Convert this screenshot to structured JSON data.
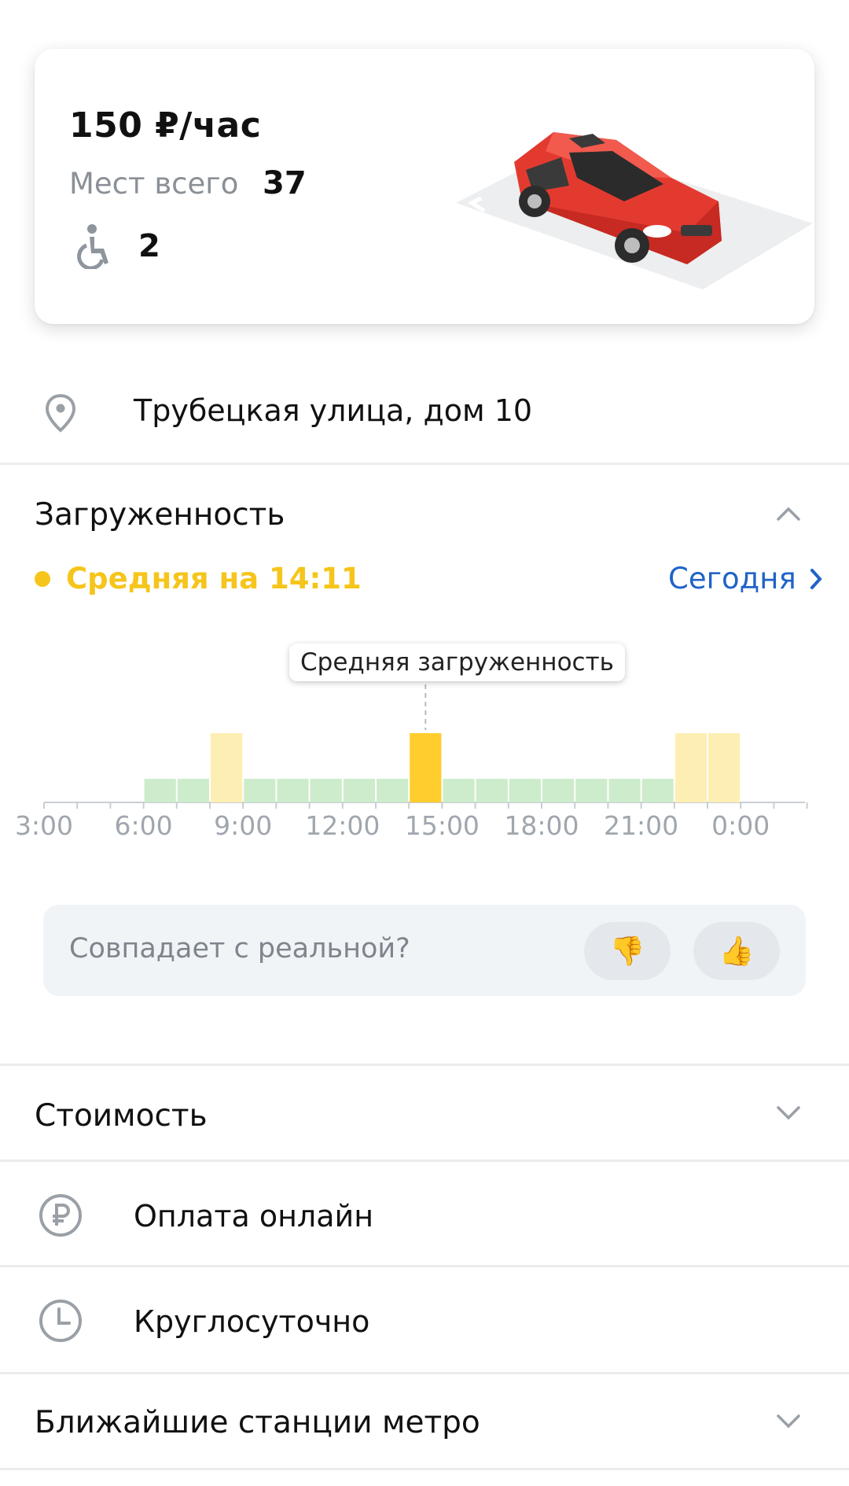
{
  "parking": {
    "price": "150 ₽/час",
    "spots_label": "Мест всего",
    "spots_total": "37",
    "disabled_spots": "2"
  },
  "address": {
    "text": "Трубецкая улица, дом 10"
  },
  "load": {
    "title": "Загруженность",
    "status": "Средняя на 14:11",
    "today_link": "Сегодня",
    "tooltip": "Средняя загруженность",
    "colors": {
      "low": "#cdeccc",
      "medium": "#fdefb3",
      "current": "#ffcd2e",
      "status": "#f6c51b",
      "link": "#1f63c8"
    }
  },
  "chart_data": {
    "type": "bar",
    "title": "Загруженность",
    "x_ticks": [
      "3:00",
      "6:00",
      "9:00",
      "12:00",
      "15:00",
      "18:00",
      "21:00",
      "0:00"
    ],
    "categories": [
      "6:00",
      "7:00",
      "8:00",
      "9:00",
      "10:00",
      "11:00",
      "12:00",
      "13:00",
      "14:00",
      "15:00",
      "16:00",
      "17:00",
      "18:00",
      "19:00",
      "20:00",
      "21:00",
      "22:00",
      "23:00"
    ],
    "values": [
      1,
      1,
      2,
      1,
      1,
      1,
      1,
      1,
      2,
      1,
      1,
      1,
      1,
      1,
      1,
      1,
      2,
      2
    ],
    "levels": [
      "low",
      "low",
      "medium",
      "low",
      "low",
      "low",
      "low",
      "low",
      "current",
      "low",
      "low",
      "low",
      "low",
      "low",
      "low",
      "low",
      "medium",
      "medium"
    ],
    "level_scale": {
      "1": "low",
      "2": "medium"
    },
    "highlight_index": 8
  },
  "feedback": {
    "question": "Совпадает с реальной?",
    "dislike_icon": "thumbs-down-icon",
    "like_icon": "thumbs-up-icon"
  },
  "rows": {
    "cost": "Стоимость",
    "online_payment": "Оплата онлайн",
    "hours": "Круглосуточно",
    "metro": "Ближайшие станции метро"
  }
}
